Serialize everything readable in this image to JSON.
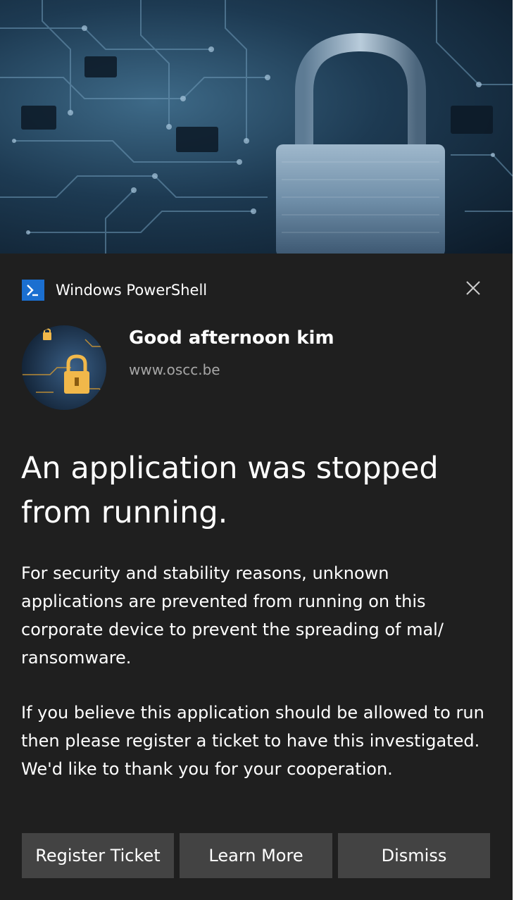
{
  "header": {
    "app_name": "Windows PowerShell",
    "app_icon": "powershell-icon",
    "close_icon": "close-icon"
  },
  "notification": {
    "title": "Good afternoon kim",
    "attribution": "www.oscc.be",
    "headline": "An application was stopped from running.",
    "body_paragraph_1": "For security and stability reasons, unknown applications are prevented from running on this corporate device to prevent the spreading of mal/ ransomware.",
    "body_paragraph_2": "If you believe this application should be allowed to run then please register a ticket to have this investigated. We'd like to thank you for your cooperation."
  },
  "buttons": [
    {
      "label": "Register Ticket"
    },
    {
      "label": "Learn More"
    },
    {
      "label": "Dismiss"
    }
  ],
  "colors": {
    "background": "#1f1f1f",
    "button": "#434343",
    "secondary_text": "#a6a6a6",
    "app_icon_blue": "#1b6fd0"
  }
}
